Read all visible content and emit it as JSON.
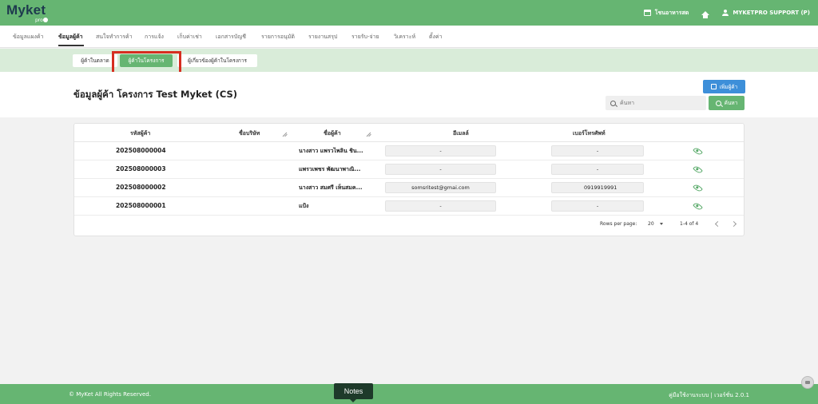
{
  "app": {
    "logo": "Myket",
    "logo_sub": "pro"
  },
  "topbar": {
    "store_label": "โชนอาหารสด",
    "user_label": "MYKETPRO SUPPORT (P)"
  },
  "nav": {
    "items": [
      "ข้อมูลแผงค้า",
      "ข้อมูลผู้ค้า",
      "สนใจทำการค้า",
      "การแจ้ง",
      "เก็บค่าเช่า",
      "เอกสารบัญชี",
      "รายการอนุมัติ",
      "รายงานสรุป",
      "รายรับ-จ่าย",
      "วิเคราะห์",
      "ตั้งค่า"
    ],
    "active_index": 1
  },
  "subtabs": {
    "items": [
      "ผู้ค้าในตลาด",
      "ผู้ค้าในโครงการ",
      "ผู้เกี่ยวข้องผู้ค้าในโครงการ"
    ],
    "active_index": 1
  },
  "header": {
    "title": "ข้อมูลผู้ค้า โครงการ Test Myket (CS)",
    "add_button": "เพิ่มผู้ค้า",
    "search_placeholder": "ค้นหา",
    "search_button": "ค้นหา"
  },
  "table": {
    "columns": [
      "รหัสผู้ค้า",
      "ชื่อบริษัท",
      "ชื่อผู้ค้า",
      "อีเมลล์",
      "เบอร์โทรศัพท์"
    ],
    "rows": [
      {
        "code": "202508000004",
        "company": "",
        "name": "นางสาว แพรวไพลิน ชิน...",
        "email": "-",
        "phone": "-"
      },
      {
        "code": "202508000003",
        "company": "",
        "name": "แพรวเพชร พัฒนาพาณิ...",
        "email": "-",
        "phone": "-"
      },
      {
        "code": "202508000002",
        "company": "",
        "name": "นางสาว สมศรี เห็นสมค...",
        "email": "somsritest@gmai.com",
        "phone": "0919919991"
      },
      {
        "code": "202508000001",
        "company": "",
        "name": "แป้ง",
        "email": "-",
        "phone": "-"
      }
    ],
    "pagination": {
      "rows_per_page_label": "Rows per page:",
      "rows_per_page": "20",
      "range": "1-4 of 4"
    }
  },
  "footer": {
    "copyright": "© MyKet All Rights Reserved.",
    "version": "คู่มือใช้งานระบบ | เวอร์ชั่น 2.0.1"
  },
  "overlay": {
    "notes": "Notes"
  },
  "colors": {
    "primary": "#66b572",
    "accent_blue": "#3d8fd9",
    "highlight": "#d62d20",
    "subtab_bar": "#d9ecd9"
  }
}
